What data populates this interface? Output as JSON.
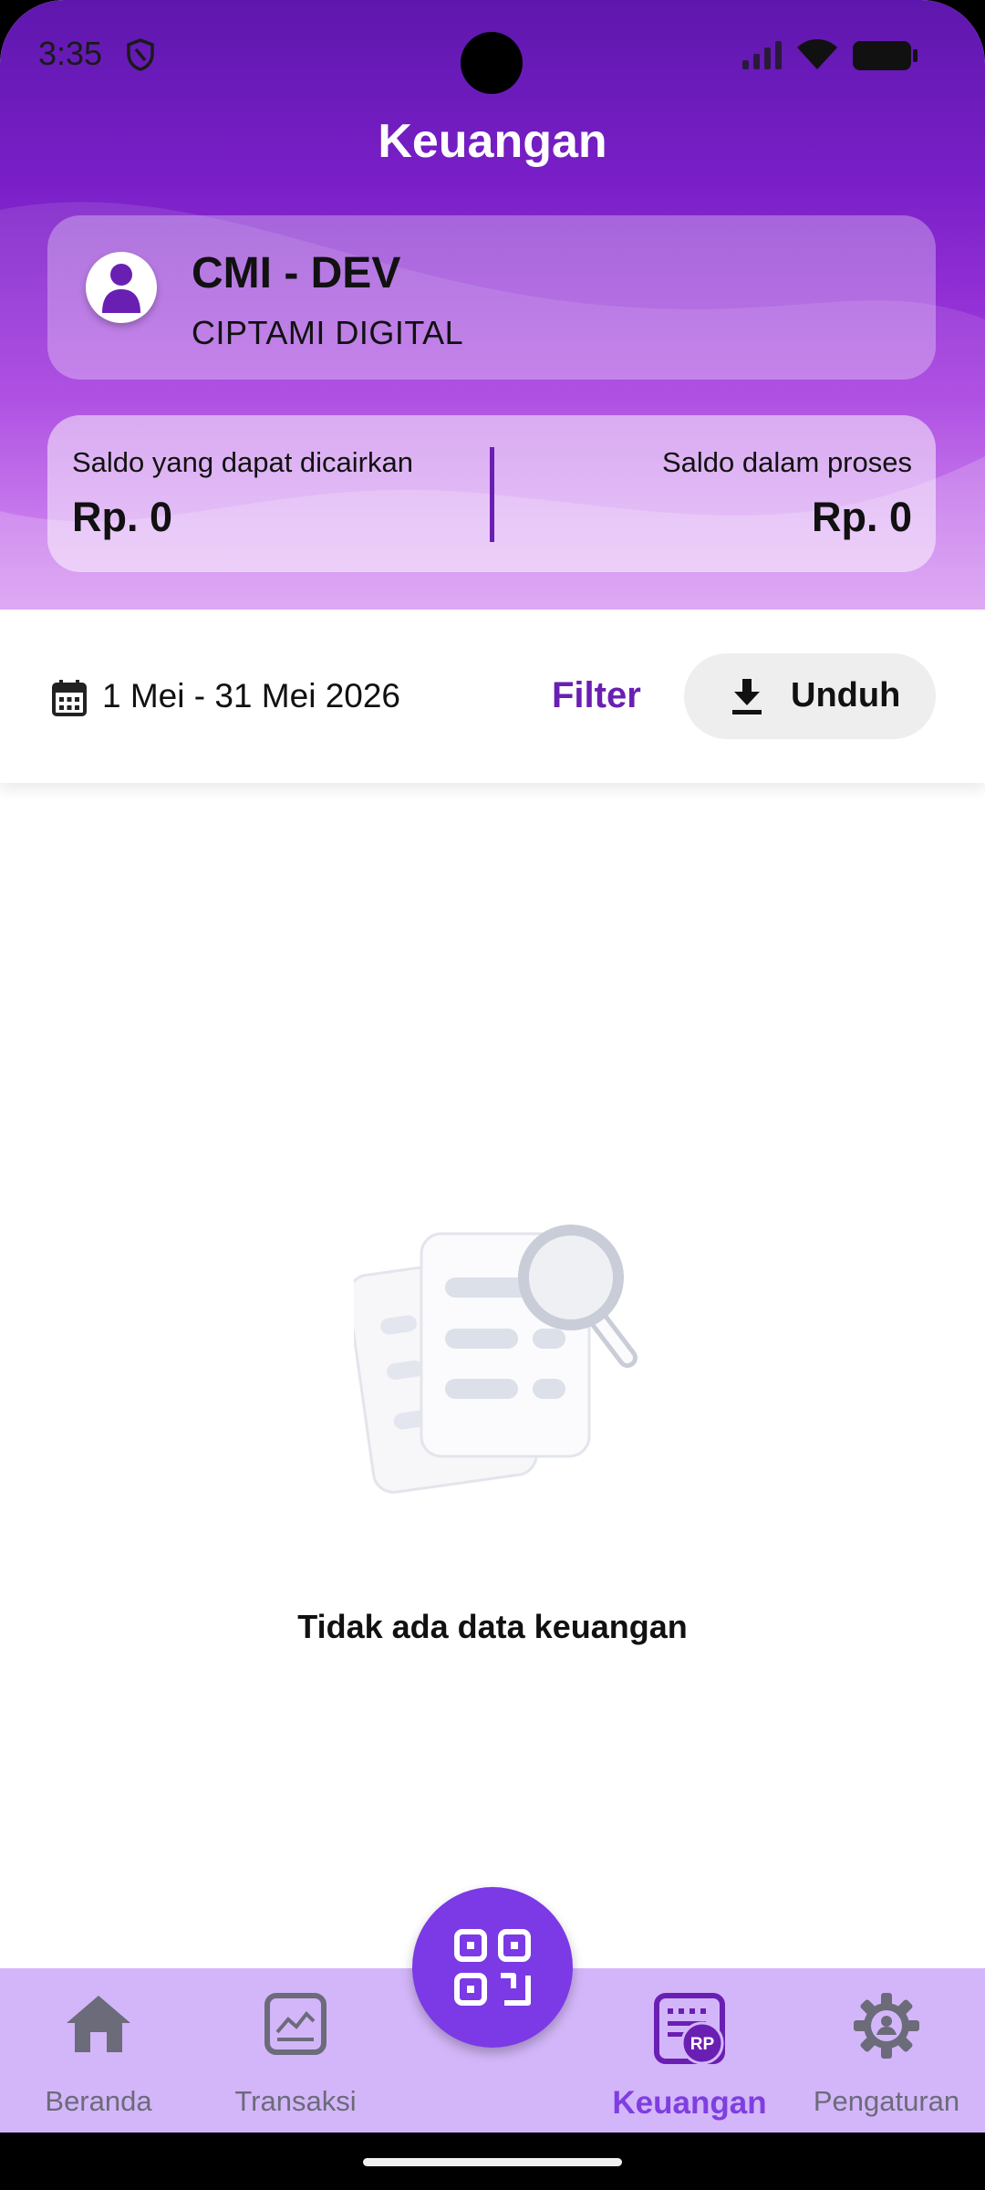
{
  "status_bar": {
    "time": "3:35"
  },
  "header": {
    "title": "Keuangan"
  },
  "merchant": {
    "name": "CMI - DEV",
    "company": "CIPTAMI DIGITAL"
  },
  "balance": {
    "withdrawable_label": "Saldo yang dapat dicairkan",
    "withdrawable_value": "Rp. 0",
    "pending_label": "Saldo dalam proses",
    "pending_value": "Rp. 0"
  },
  "filter_bar": {
    "date_range": "1 Mei - 31 Mei 2026",
    "filter_label": "Filter",
    "download_label": "Unduh"
  },
  "empty_state": {
    "message": "Tidak ada data keuangan"
  },
  "bottom_nav": {
    "items": [
      {
        "label": "Beranda",
        "icon": "home-icon"
      },
      {
        "label": "Transaksi",
        "icon": "chart-icon"
      },
      {
        "label": "Keuangan",
        "icon": "finance-icon",
        "active": true,
        "badge": "RP"
      },
      {
        "label": "Pengaturan",
        "icon": "settings-icon"
      }
    ],
    "fab_icon": "qr-code-icon"
  },
  "colors": {
    "primary": "#6a1fb3",
    "accent": "#7b3ae5",
    "nav_background": "#d3b6f9",
    "inactive_nav": "#6b6b7a"
  }
}
